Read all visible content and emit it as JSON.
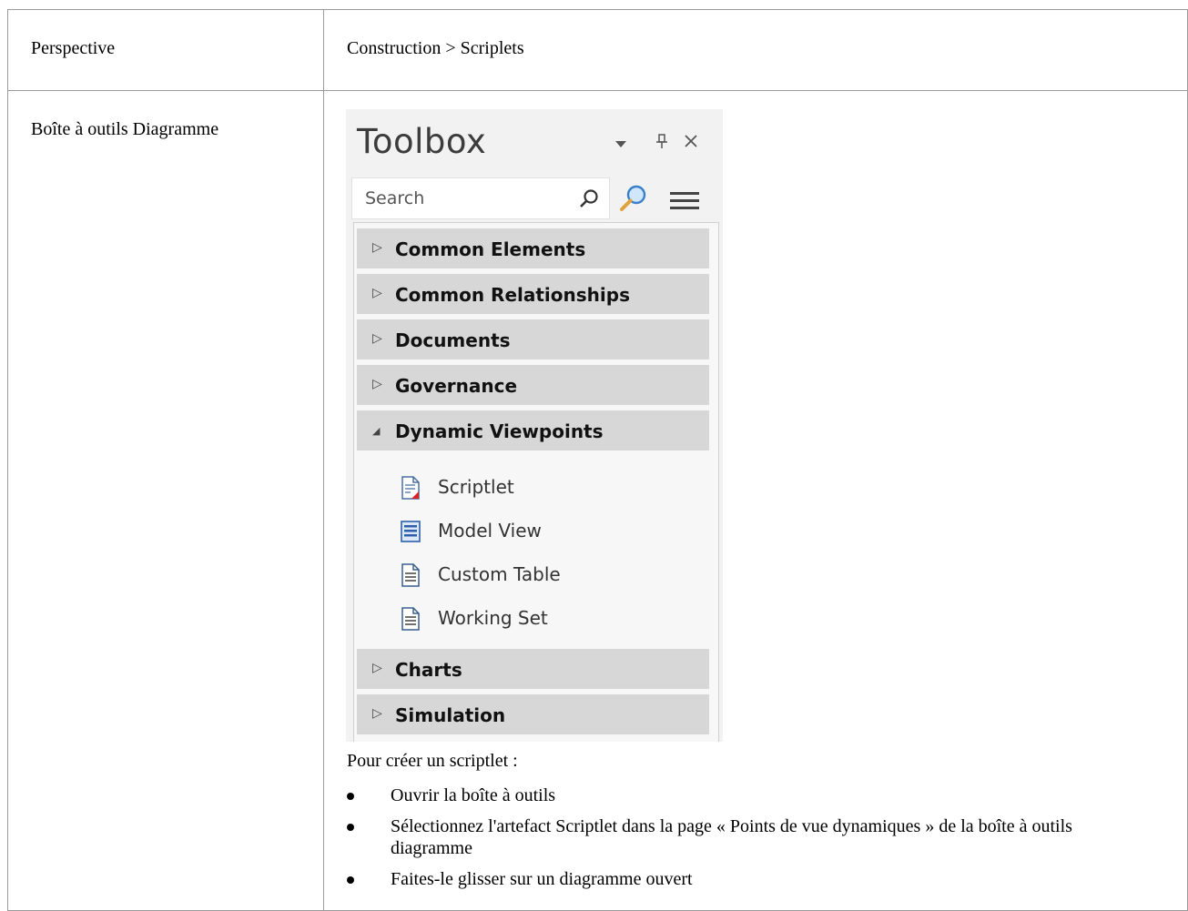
{
  "table": {
    "row1": {
      "label": "Perspective",
      "value": "Construction > Scriplets"
    },
    "row2": {
      "label": "Boîte à outils Diagramme"
    }
  },
  "toolbox": {
    "title": "Toolbox",
    "controls": {
      "dropdown_icon": "chevron-down-icon",
      "pin_icon": "pin-icon",
      "close_icon": "close-icon"
    },
    "search": {
      "placeholder": "Search",
      "value": ""
    },
    "categories_top": [
      {
        "label": "Common Elements",
        "expanded": false
      },
      {
        "label": "Common Relationships",
        "expanded": false
      },
      {
        "label": "Documents",
        "expanded": false
      },
      {
        "label": "Governance",
        "expanded": false
      },
      {
        "label": "Dynamic Viewpoints",
        "expanded": true
      }
    ],
    "items": [
      {
        "label": "Scriptlet",
        "icon": "scriptlet-icon"
      },
      {
        "label": "Model View",
        "icon": "model-view-icon"
      },
      {
        "label": "Custom Table",
        "icon": "custom-table-icon"
      },
      {
        "label": "Working Set",
        "icon": "working-set-icon"
      }
    ],
    "categories_bottom": [
      {
        "label": "Charts",
        "expanded": false
      },
      {
        "label": "Simulation",
        "expanded": false
      }
    ]
  },
  "instructions": {
    "intro": "Pour créer un scriptlet :",
    "steps": [
      "Ouvrir la boîte à outils",
      "Sélectionnez l'artefact Scriptlet dans la page « Points de vue dynamiques » de la boîte à outils diagramme",
      "Faites-le glisser sur un diagramme ouvert"
    ]
  }
}
